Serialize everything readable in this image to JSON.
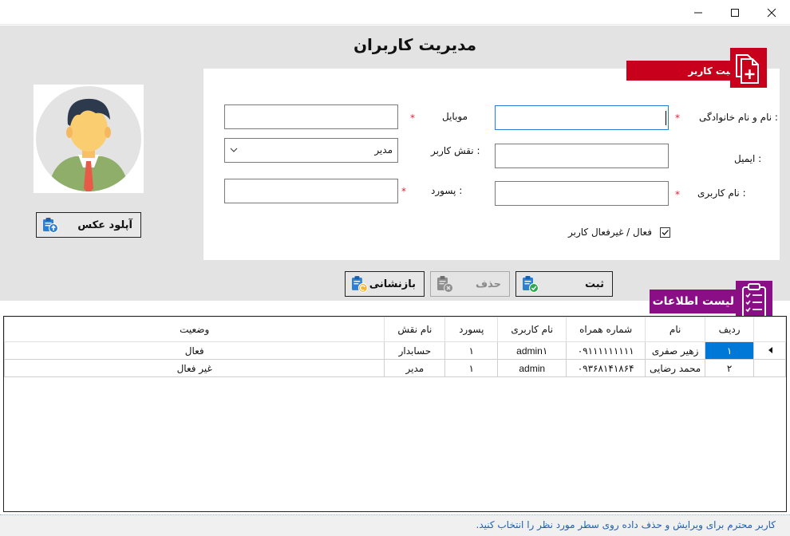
{
  "window": {
    "title": "مدیریت کاربران"
  },
  "register_section": {
    "tag": "ثبت کاربر"
  },
  "photo": {
    "upload_label": "آپلود عکس"
  },
  "form": {
    "fullname": {
      "label": "نام و نام خانوادگی :",
      "value": ""
    },
    "mobile": {
      "label": "موبایل",
      "value": ""
    },
    "email": {
      "label": "ایمیل :",
      "value": ""
    },
    "role": {
      "label": "نقش کاربر :",
      "selected": "مدیر"
    },
    "username": {
      "label": "نام کاربری :",
      "value": ""
    },
    "password": {
      "label": "پسورد :",
      "value": ""
    },
    "required_mark": "*",
    "active_checkbox": {
      "label": "فعال / غیرفعال کاربر",
      "checked": true
    }
  },
  "actions": {
    "save": "ثبت",
    "delete": "حذف",
    "reset": "بازنشانی"
  },
  "list_section": {
    "tag": "لیست اطلاعات"
  },
  "grid": {
    "columns": [
      "ردیف",
      "نام",
      "شماره همراه",
      "نام کاربری",
      "پسورد",
      "نام نقش",
      "وضعیت"
    ],
    "rows": [
      {
        "row": "۱",
        "name": "زهیر صفری",
        "mobile": "۰۹۱۱۱۱۱۱۱۱۱",
        "username": "admin۱",
        "password": "۱",
        "role": "حسابدار",
        "status": "فعال"
      },
      {
        "row": "۲",
        "name": "محمد رضایی",
        "mobile": "۰۹۳۶۸۱۴۱۸۶۴",
        "username": "admin",
        "password": "۱",
        "role": "مدیر",
        "status": "غیر فعال"
      }
    ]
  },
  "status_bar": {
    "message": "کاربر محترم برای ویرایش و حذف داده روی سطر مورد نظر را انتخاب کنید."
  },
  "colors": {
    "register_tag": "#c8001b",
    "list_tag": "#8a0f86",
    "selection": "#0078d7",
    "required": "#d6263a"
  }
}
